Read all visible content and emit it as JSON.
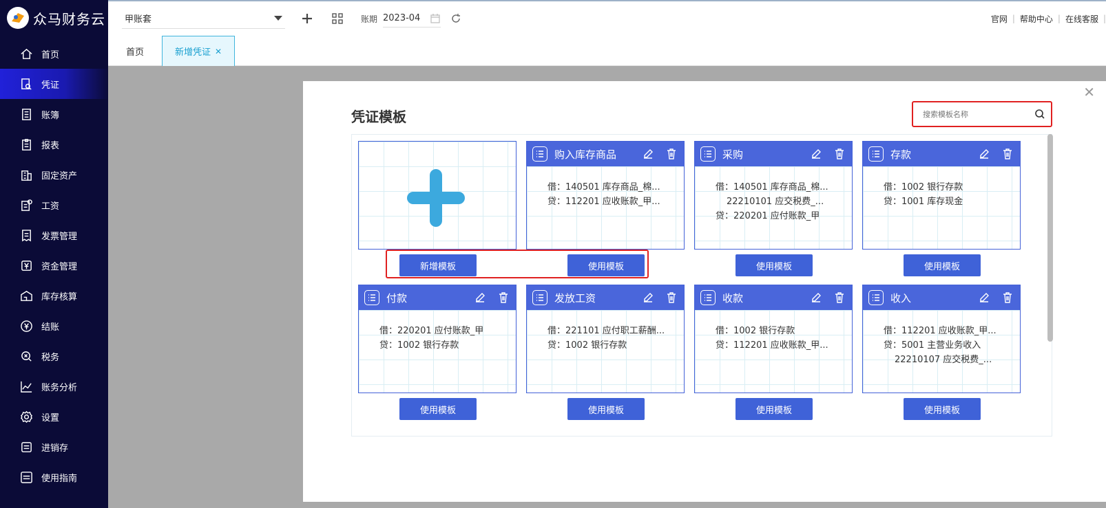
{
  "app": {
    "logo_text": "众马财务云"
  },
  "sidebar": {
    "items": [
      {
        "label": "首页",
        "icon": "home-icon"
      },
      {
        "label": "凭证",
        "icon": "voucher-icon",
        "active": true
      },
      {
        "label": "账簿",
        "icon": "ledger-icon"
      },
      {
        "label": "报表",
        "icon": "report-icon"
      },
      {
        "label": "固定资产",
        "icon": "building-icon"
      },
      {
        "label": "工资",
        "icon": "salary-icon"
      },
      {
        "label": "发票管理",
        "icon": "invoice-icon"
      },
      {
        "label": "资金管理",
        "icon": "yen-icon"
      },
      {
        "label": "库存核算",
        "icon": "warehouse-icon"
      },
      {
        "label": "结账",
        "icon": "yen-circle-icon"
      },
      {
        "label": "税务",
        "icon": "tax-icon"
      },
      {
        "label": "账务分析",
        "icon": "chart-icon"
      },
      {
        "label": "设置",
        "icon": "gear-icon"
      },
      {
        "label": "进销存",
        "icon": "inventory-icon"
      },
      {
        "label": "使用指南",
        "icon": "guide-icon"
      }
    ]
  },
  "topbar": {
    "account_set": "甲账套",
    "period_label": "账期",
    "period_value": "2023-04",
    "links": [
      "官网",
      "帮助中心",
      "在线客服"
    ]
  },
  "tabs": {
    "home": "首页",
    "active": "新增凭证"
  },
  "modal": {
    "title": "凭证模板",
    "search_placeholder": "搜索模板名称",
    "add_button": "新增模板",
    "use_button": "使用模板",
    "templates": [
      {
        "name": "购入库存商品",
        "lines": [
          "借：140501 库存商品_棉...",
          "贷：112201 应收账款_甲..."
        ]
      },
      {
        "name": "采购",
        "lines": [
          "借：140501 库存商品_棉...",
          "22210101 应交税费_...",
          "贷：220201 应付账款_甲"
        ]
      },
      {
        "name": "存款",
        "lines": [
          "借：1002 银行存款",
          "贷：1001 库存现金"
        ]
      },
      {
        "name": "付款",
        "lines": [
          "借：220201 应付账款_甲",
          "贷：1002 银行存款"
        ]
      },
      {
        "name": "发放工资",
        "lines": [
          "借：221101 应付职工薪酬...",
          "贷：1002 银行存款"
        ]
      },
      {
        "name": "收款",
        "lines": [
          "借：1002 银行存款",
          "贷：112201 应收账款_甲..."
        ]
      },
      {
        "name": "收入",
        "lines": [
          "借：112201 应收账款_甲...",
          "贷：5001 主营业务收入",
          "22210107 应交税费_..."
        ]
      }
    ]
  },
  "colors": {
    "sidebar_bg": "#0b0b37",
    "active_nav": "#2121d9",
    "card_header": "#4a66db",
    "button": "#3f62d8",
    "plus": "#3ca9de",
    "highlight": "#e02020"
  }
}
